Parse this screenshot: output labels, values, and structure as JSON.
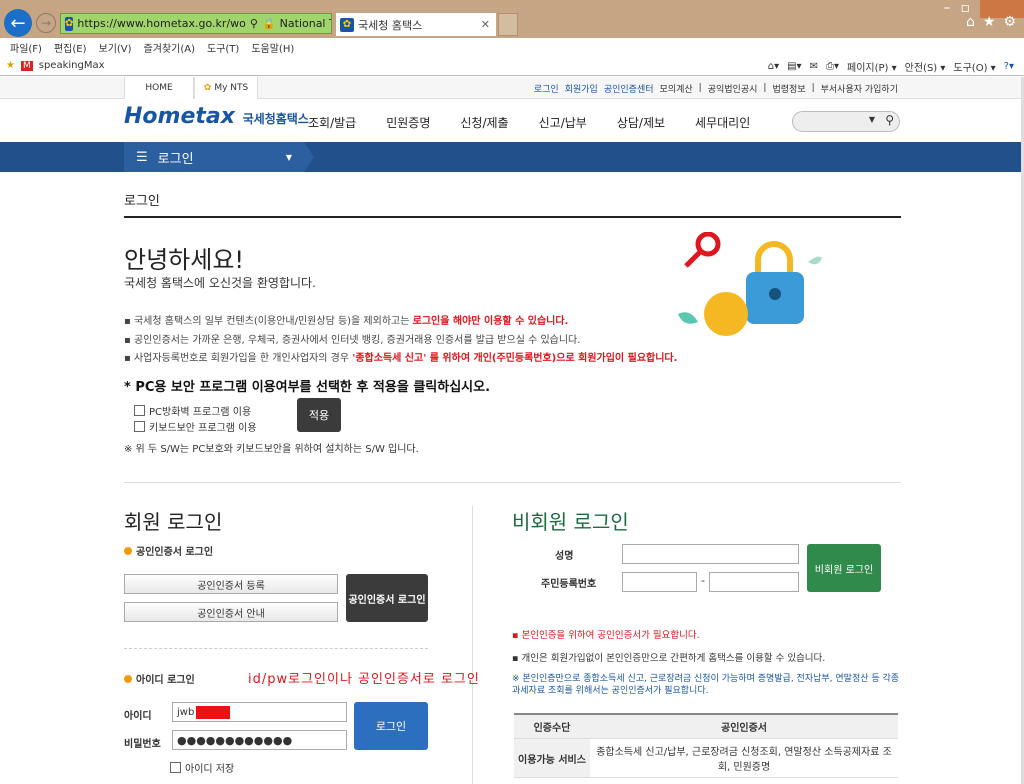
{
  "browser": {
    "url": "https://www.hometax.go.kr/wo",
    "site_identity": "National Ta...",
    "tab_title": "국세청 홈택스",
    "menu": [
      "파일(F)",
      "편집(E)",
      "보기(V)",
      "즐겨찾기(A)",
      "도구(T)",
      "도움말(H)"
    ],
    "favorite": "speakingMax",
    "commands": [
      "페이지(P) ▾",
      "안전(S) ▾",
      "도구(O) ▾"
    ]
  },
  "gnb": {
    "home": "HOME",
    "mynts": "My NTS",
    "utils": [
      "로그인",
      "회원가입",
      "공인인증센터",
      "모의계산",
      "공익법인공시",
      "법령정보",
      "부서사용자 가입하기"
    ]
  },
  "header": {
    "logo": "Hometax",
    "logo_sub": "국세청홈택스",
    "nav": [
      "조회/발급",
      "민원증명",
      "신청/제출",
      "신고/납부",
      "상담/제보",
      "세무대리인"
    ]
  },
  "lnb": {
    "label": "로그인"
  },
  "page": {
    "title": "로그인",
    "hello": "안녕하세요!",
    "welcome": "국세청 홈택스에 오신것을 환영합니다.",
    "notes": [
      {
        "a": "국세청 홈택스의 일부 컨텐츠(이용안내/민원상담 등)을 제외하고는 ",
        "b": "로그인을 해야만 이용할 수 있습니다.",
        "c": ""
      },
      {
        "a": "공인인증서는 가까운 은행, 우체국, 증권사에서 인터넷 뱅킹, 증권거래용 인증서를 발급 받으실 수 있습니다.",
        "b": "",
        "c": ""
      },
      {
        "a": "사업자등록번호로 회원가입을 한 개인사업자의 경우 ",
        "b": "'종합소득세 신고' 를 위하여 개인(주민등록번호)으로 회원가입이 필요합니다.",
        "c": ""
      }
    ],
    "pc_note": "* PC용 보안 프로그램 이용여부를 선택한 후 적용을 클릭하십시오.",
    "chk1": "PC방화벽 프로그램 이용",
    "chk2": "키보드보안 프로그램 이용",
    "apply": "적용",
    "sw_note": "※ 위 두 S/W는 PC보호와 키보드보안을 위하여 설치하는 S/W 입니다."
  },
  "member": {
    "heading": "회원 로그인",
    "cert_section": "공인인증서 로그인",
    "cert_register": "공인인증서 등록",
    "cert_guide": "공인인증서 안내",
    "cert_login": "공인인증서 로그인",
    "id_section": "아이디 로그인",
    "hint": "id/pw로그인이나 공인인증서로 로그인",
    "id_label": "아이디",
    "id_value": "jwb",
    "pw_label": "비밀번호",
    "pw_value": "●●●●●●●●●●●●",
    "login": "로그인",
    "save_id": "아이디 저장"
  },
  "nonmember": {
    "heading": "비회원 로그인",
    "name_label": "성명",
    "rrn_label": "주민등록번호",
    "dash": "-",
    "button": "비회원 로그인",
    "note1": "본인인증을 위하여 공인인증서가 필요합니다.",
    "note2": "개인은 회원가입없이 본인인증만으로 간편하게 홈택스를 이용할 수 있습니다.",
    "note3": "※ 본인인증만으로 종합소득세 신고, 근로장려금 신청이 가능하며 증명발급, 전자납부, 연말정산 등 각종 과세자료 조회를 위해서는 공인인증서가 필요합니다.",
    "table": {
      "h1": "인증수단",
      "h2": "공인인증서",
      "r1": "이용가능 서비스",
      "r2": "종합소득세 신고/납부, 근로장려금 신청조회, 연말정산 소득공제자료 조회, 민원증명"
    }
  },
  "colors": {
    "brand": "#1a56a0",
    "nav_bar": "#22508a",
    "non_member": "#2f8a4c",
    "alert": "#e0161e"
  }
}
